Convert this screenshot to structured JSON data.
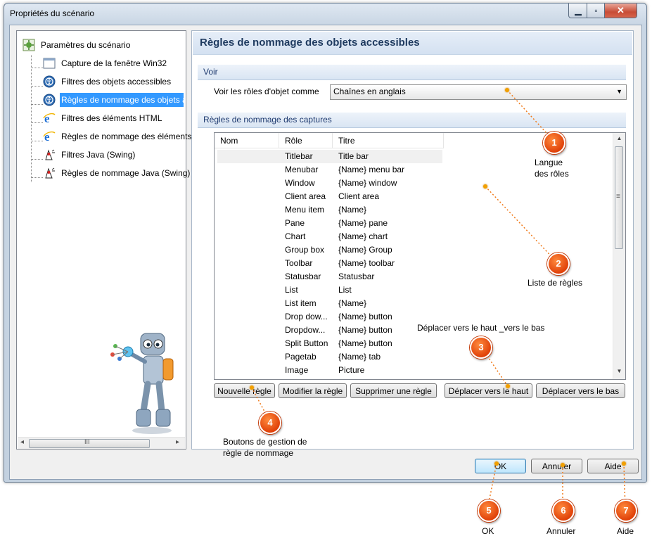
{
  "window": {
    "title": "Propriétés du scénario",
    "minimize_glyph": "▁",
    "maximize_glyph": "▫",
    "close_glyph": "✕"
  },
  "tree": {
    "items": [
      {
        "label": "Paramètres du scénario",
        "icon": "scenario-settings-icon"
      },
      {
        "label": "Capture de la fenêtre Win32",
        "icon": "window-icon"
      },
      {
        "label": "Filtres des objets accessibles",
        "icon": "accessibility-icon"
      },
      {
        "label": "Règles de nommage des objets accessibles",
        "icon": "accessibility-icon"
      },
      {
        "label": "Filtres des éléments HTML",
        "icon": "internet-explorer-icon"
      },
      {
        "label": "Règles de nommage des éléments HTML",
        "icon": "internet-explorer-icon"
      },
      {
        "label": "Filtres Java (Swing)",
        "icon": "java-duke-icon"
      },
      {
        "label": "Règles de nommage Java (Swing)",
        "icon": "java-duke-icon"
      }
    ],
    "scroll_left": "◂",
    "scroll_right": "▸",
    "scroll_grip": "III"
  },
  "panel": {
    "title": "Règles de nommage des objets accessibles",
    "section_view": "Voir",
    "roles_label": "Voir les rôles d'objet comme",
    "roles_value": "Chaînes en anglais",
    "section_rules": "Règles de nommage des captures",
    "columns": [
      "Nom",
      "Rôle",
      "Titre"
    ],
    "rows": [
      {
        "name": "",
        "role": "Titlebar",
        "title": "Title bar"
      },
      {
        "name": "",
        "role": "Menubar",
        "title": "{Name} menu bar"
      },
      {
        "name": "",
        "role": "Window",
        "title": "{Name} window"
      },
      {
        "name": "",
        "role": "Client area",
        "title": "Client area"
      },
      {
        "name": "",
        "role": "Menu item",
        "title": "{Name}"
      },
      {
        "name": "",
        "role": "Pane",
        "title": "{Name} pane"
      },
      {
        "name": "",
        "role": "Chart",
        "title": "{Name} chart"
      },
      {
        "name": "",
        "role": "Group box",
        "title": "{Name} Group"
      },
      {
        "name": "",
        "role": "Toolbar",
        "title": "{Name} toolbar"
      },
      {
        "name": "",
        "role": "Statusbar",
        "title": "Statusbar"
      },
      {
        "name": "",
        "role": "List",
        "title": "List"
      },
      {
        "name": "",
        "role": "List item",
        "title": "{Name}"
      },
      {
        "name": "",
        "role": "Drop dow...",
        "title": "{Name} button"
      },
      {
        "name": "",
        "role": "Dropdow...",
        "title": "{Name} button"
      },
      {
        "name": "",
        "role": "Split Button",
        "title": "{Name} button"
      },
      {
        "name": "",
        "role": "Pagetab",
        "title": "{Name} tab"
      },
      {
        "name": "",
        "role": "Image",
        "title": "Picture"
      }
    ],
    "buttons": {
      "new_rule": "Nouvelle règle",
      "modify_rule": "Modifier la règle",
      "delete_rule": "Supprimer une règle",
      "move_up": "Déplacer vers le haut",
      "move_down": "Déplacer vers le bas"
    },
    "scroll_up": "▲",
    "scroll_down": "▼",
    "scroll_grip": "≡"
  },
  "dialog_buttons": {
    "ok": "OK",
    "cancel": "Annuler",
    "help": "Aide"
  },
  "callouts": [
    {
      "number": "1",
      "text": "Langue\ndes rôles"
    },
    {
      "number": "2",
      "text": "Liste de règles"
    },
    {
      "number": "3",
      "text": "Déplacer vers le haut _vers le bas"
    },
    {
      "number": "4",
      "text": "Boutons de gestion de\nrègle de nommage"
    },
    {
      "number": "5",
      "text": "OK"
    },
    {
      "number": "6",
      "text": "Annuler"
    },
    {
      "number": "7",
      "text": "Aide"
    }
  ],
  "colors": {
    "accent_selection": "#3399ff",
    "callout_orange": "#e8520f",
    "panel_title": "#1e3a5f"
  }
}
